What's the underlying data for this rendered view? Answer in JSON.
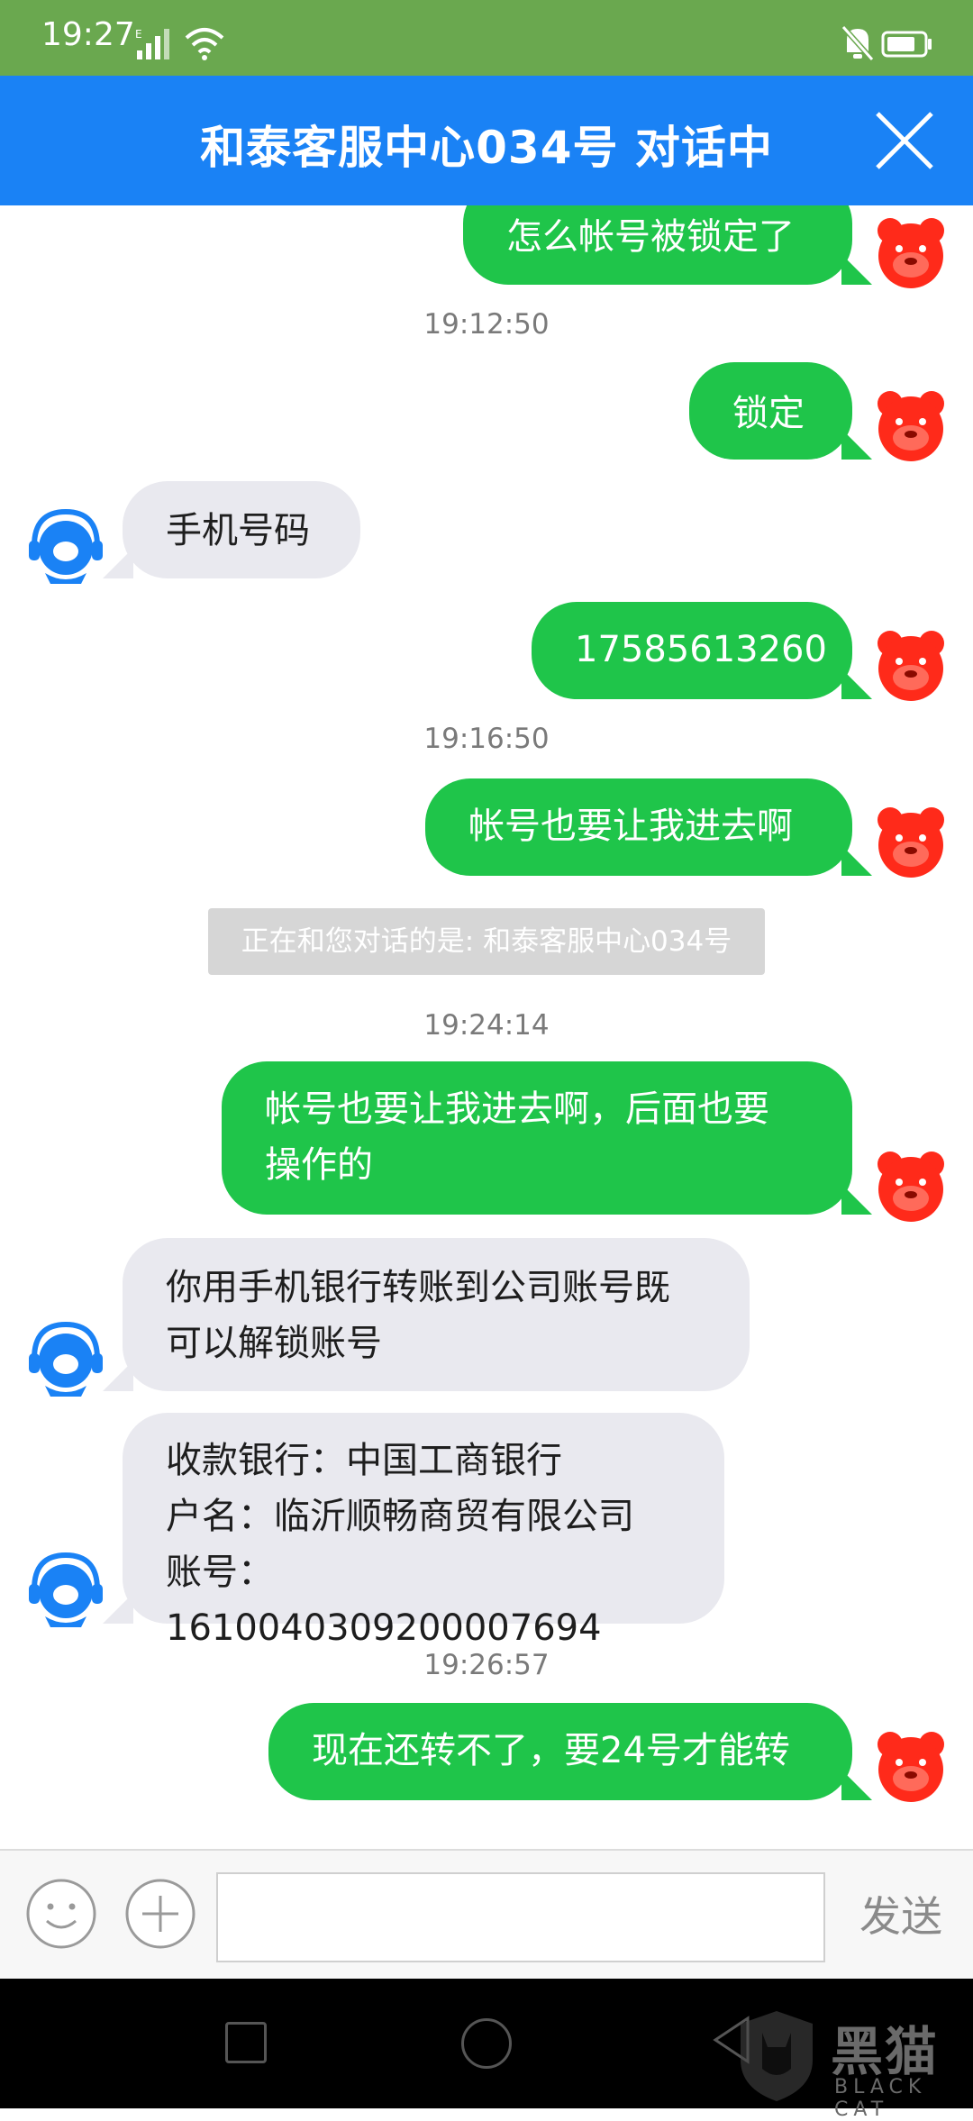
{
  "status_bar": {
    "time": "19:27",
    "signal_label": "E"
  },
  "header": {
    "title": "和泰客服中心034号  对话中"
  },
  "messages": {
    "m1": "怎么帐号被锁定了",
    "t1": "19:12:50",
    "m2": "锁定",
    "m3": "手机号码",
    "m4": "17585613260",
    "t2": "19:16:50",
    "m5": "帐号也要让我进去啊",
    "notice": "正在和您对话的是: 和泰客服中心034号",
    "t3": "19:24:14",
    "m6": "帐号也要让我进去啊，后面也要\n操作的",
    "m7": "你用手机银行转账到公司账号既\n可以解锁账号",
    "m8": "收款银行：中国工商银行\n户名：临沂顺畅商贸有限公司\n账号：1610040309200007694",
    "t4": "19:26:57",
    "m9": "现在还转不了，要24号才能转"
  },
  "input_bar": {
    "placeholder": "",
    "send_label": "发送"
  },
  "watermark": {
    "text": "黑猫",
    "sub": "BLACK CAT"
  },
  "colors": {
    "status_bar": "#6aa84f",
    "header": "#1a82f5",
    "user_bubble": "#1fc54a",
    "agent_bubble": "#e9e9ef"
  }
}
